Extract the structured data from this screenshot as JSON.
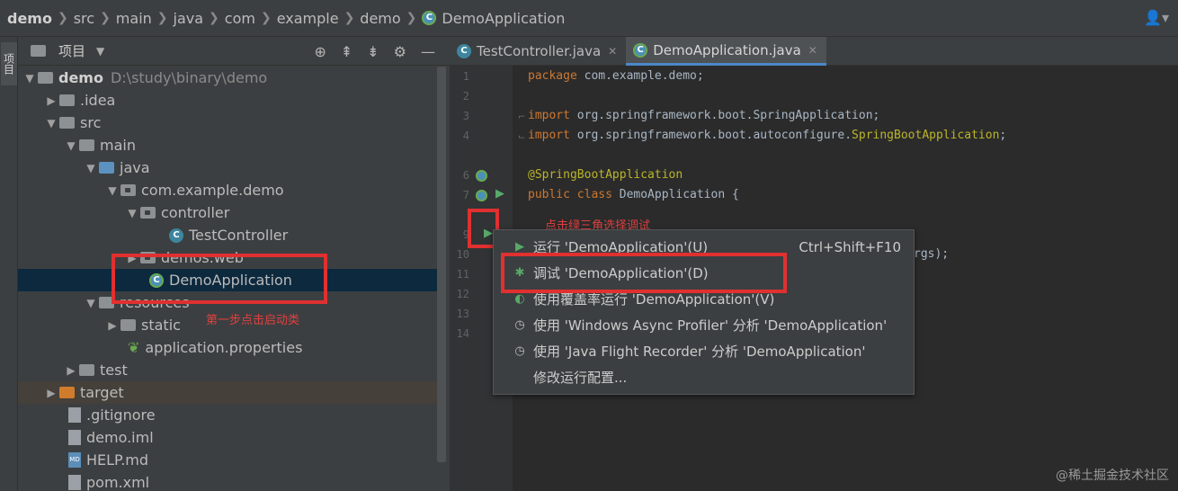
{
  "breadcrumb": [
    "demo",
    "src",
    "main",
    "java",
    "com",
    "example",
    "demo",
    "DemoApplication"
  ],
  "toolstrip": {
    "project_tab": "项目"
  },
  "project_panel": {
    "title": "项目",
    "tree": [
      {
        "label": "demo",
        "path": "D:\\study\\binary\\demo"
      },
      {
        "label": ".idea"
      },
      {
        "label": "src"
      },
      {
        "label": "main"
      },
      {
        "label": "java"
      },
      {
        "label": "com.example.demo"
      },
      {
        "label": "controller"
      },
      {
        "label": "TestController"
      },
      {
        "label": "demos.web"
      },
      {
        "label": "DemoApplication"
      },
      {
        "label": "resources"
      },
      {
        "label": "static"
      },
      {
        "label": "application.properties"
      },
      {
        "label": "test"
      },
      {
        "label": "target"
      },
      {
        "label": ".gitignore"
      },
      {
        "label": "demo.iml"
      },
      {
        "label": "HELP.md"
      },
      {
        "label": "pom.xml"
      }
    ]
  },
  "annotations": {
    "step1": "第一步点击启动类",
    "step2": "点击绿三角选择调试"
  },
  "editor": {
    "tabs": [
      {
        "label": "TestController.java"
      },
      {
        "label": "DemoApplication.java"
      }
    ],
    "line_numbers": [
      "1",
      "2",
      "3",
      "4",
      "5",
      "6",
      "7",
      "8",
      "9",
      "10",
      "11",
      "12",
      "13",
      "14"
    ],
    "code": {
      "l1_kw": "package",
      "l1_rest": " com.example.demo;",
      "l3_kw": "import",
      "l3_rest": " org.springframework.boot.SpringApplication;",
      "l4_kw": "import",
      "l4_rest": " org.springframework.boot.autoconfigure.",
      "l4_ann": "SpringBootApplication",
      "l4_end": ";",
      "l6_ann": "@SpringBootApplication",
      "l7_kw": "public class",
      "l7_rest": " DemoApplication {",
      "l10_tail": "rgs);"
    }
  },
  "context_menu": {
    "items": [
      {
        "label": "运行 'DemoApplication'(U)",
        "shortcut": "Ctrl+Shift+F10",
        "icon": "run-icon"
      },
      {
        "label": "调试 'DemoApplication'(D)",
        "icon": "debug-icon"
      },
      {
        "label": "使用覆盖率运行 'DemoApplication'(V)",
        "icon": "coverage-icon"
      },
      {
        "label": "使用 'Windows Async Profiler' 分析  'DemoApplication'",
        "icon": "profiler-icon"
      },
      {
        "label": "使用 'Java Flight Recorder' 分析  'DemoApplication'",
        "icon": "recorder-icon"
      },
      {
        "label": "修改运行配置..."
      }
    ]
  },
  "watermark": "@稀土掘金技术社区"
}
